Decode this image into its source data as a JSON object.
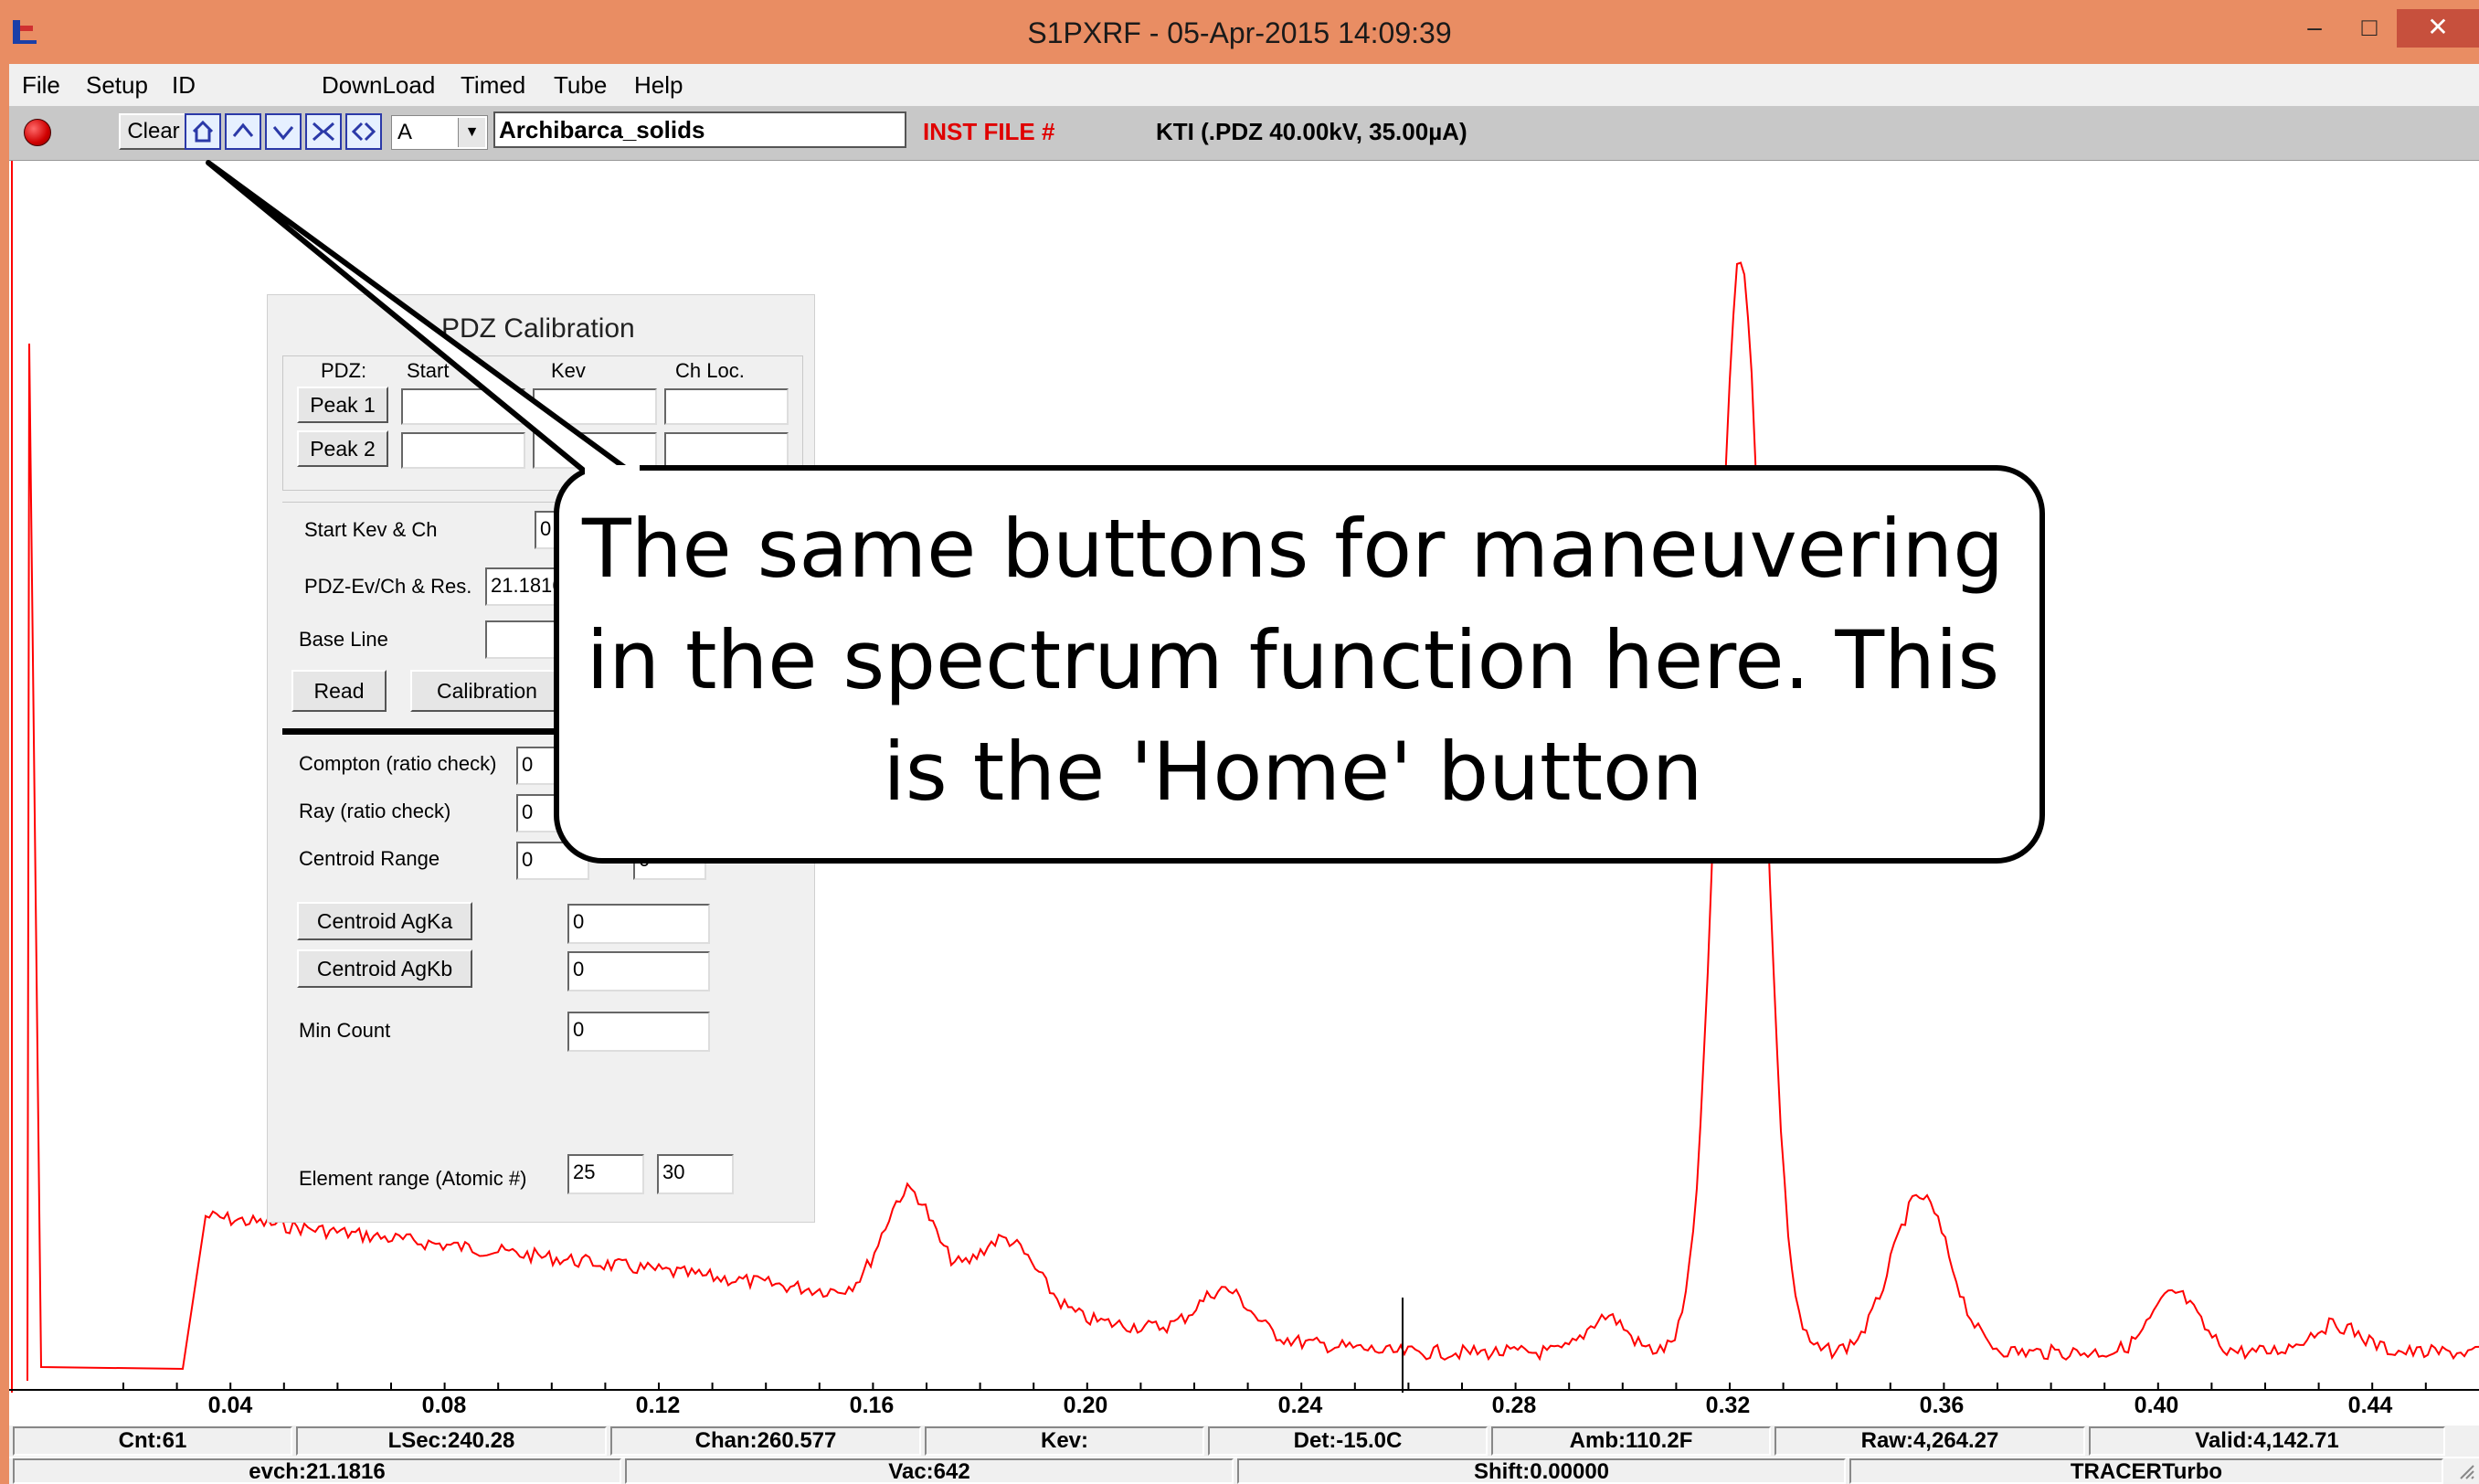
{
  "window": {
    "title": "S1PXRF - 05-Apr-2015 14:09:39",
    "minimize": "–",
    "maximize": "□",
    "close": "✕"
  },
  "menu": [
    "File",
    "Setup",
    "ID",
    "DownLoad",
    "Timed",
    "Tube",
    "Help"
  ],
  "toolbar": {
    "clear_label": "Clear",
    "select_value": "A",
    "file_name": "Archibarca_solids",
    "inst_file": "INST FILE #",
    "kti": "KTI  (.PDZ 40.00kV, 35.00µA)"
  },
  "calibration": {
    "title": "PDZ Calibration",
    "headers": {
      "pdz": "PDZ:",
      "start": "Start",
      "kev": "Kev",
      "ch_loc": "Ch Loc."
    },
    "peak1": "Peak 1",
    "peak2": "Peak 2",
    "start_kev_ch": "Start Kev & Ch",
    "start_kev_value": "0",
    "pdz_ev": "PDZ-Ev/Ch & Res.",
    "pdz_ev_value": "21.1816",
    "base_line": "Base Line",
    "read": "Read",
    "calibration_btn": "Calibration",
    "compton": "Compton (ratio check)",
    "compton_value": "0",
    "ray": "Ray (ratio check)",
    "ray_value": "0",
    "centroid_range": "Centroid Range",
    "centroid_range_value": "0",
    "centroid_range_value2": "0",
    "centroid_agka": "Centroid AgKa",
    "centroid_agka_value": "0",
    "centroid_agkb": "Centroid AgKb",
    "centroid_agkb_value": "0",
    "min_count": "Min Count",
    "min_count_value": "0",
    "element_range": "Element range (Atomic #)",
    "element_from": "25",
    "element_to": "30"
  },
  "callout": {
    "line1": "The same buttons for maneuvering",
    "line2": "in the spectrum function here. This",
    "line3": "is the 'Home' button"
  },
  "axis_ticks": [
    "0.04",
    "0.08",
    "0.12",
    "0.16",
    "0.20",
    "0.24",
    "0.28",
    "0.32",
    "0.36",
    "0.40",
    "0.44"
  ],
  "status": {
    "cnt": "Cnt:61",
    "lsec": "LSec:240.28",
    "chan": "Chan:260.577",
    "kev": "Kev:",
    "det": "Det:-15.0C",
    "amb": "Amb:110.2F",
    "raw": "Raw:4,264.27",
    "valid": "Valid:4,142.71",
    "evch": "evch:21.1816",
    "vac": "Vac:642",
    "shift": "Shift:0.00000",
    "instrument": "TRACERTurbo"
  },
  "colors": {
    "title_bar": "#e98d63",
    "close_button": "#c7503d",
    "spectrum_line": "#ff0000",
    "inst_file": "#e00000",
    "nav_button": "#2b39a8"
  },
  "icons": [
    "app-icon",
    "record-icon",
    "home-icon",
    "up-icon",
    "down-icon",
    "zoom-in-icon",
    "zoom-out-icon",
    "chevron-down-icon",
    "resize-grip-icon"
  ]
}
